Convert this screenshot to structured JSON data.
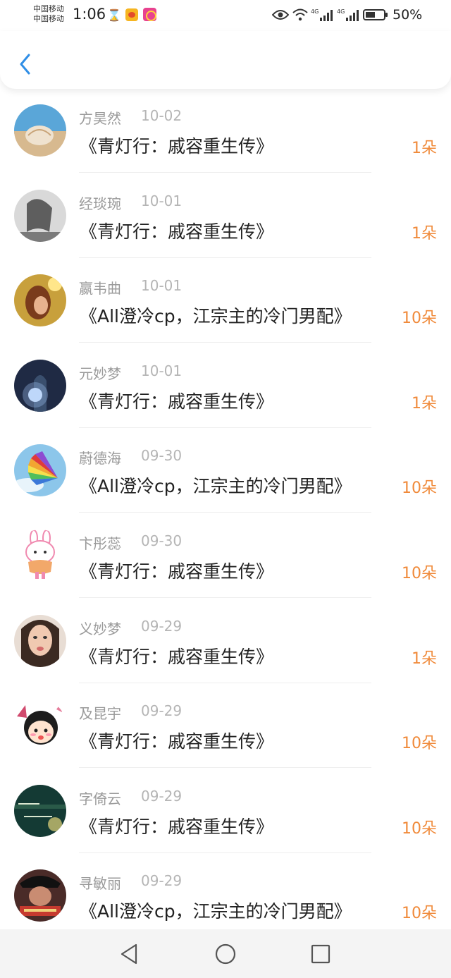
{
  "status_bar": {
    "carrier1": "中国移动",
    "carrier2": "中国移动",
    "time": "1:06",
    "signal1_label": "4G",
    "signal2_label": "4G",
    "battery_pct": "50%"
  },
  "feed": [
    {
      "name": "方昊然",
      "date": "10-02",
      "title": "《青灯行：戚容重生传》",
      "count": "1朵"
    },
    {
      "name": "经琰琬",
      "date": "10-01",
      "title": "《青灯行：戚容重生传》",
      "count": "1朵"
    },
    {
      "name": "嬴韦曲",
      "date": "10-01",
      "title": "《All澄冷cp，江宗主的冷门男配》",
      "count": "10朵"
    },
    {
      "name": "元妙梦",
      "date": "10-01",
      "title": "《青灯行：戚容重生传》",
      "count": "1朵"
    },
    {
      "name": "蔚德海",
      "date": "09-30",
      "title": "《All澄冷cp，江宗主的冷门男配》",
      "count": "10朵"
    },
    {
      "name": "卞彤蕊",
      "date": "09-30",
      "title": "《青灯行：戚容重生传》",
      "count": "10朵"
    },
    {
      "name": "义妙梦",
      "date": "09-29",
      "title": "《青灯行：戚容重生传》",
      "count": "1朵"
    },
    {
      "name": "及昆宇",
      "date": "09-29",
      "title": "《青灯行：戚容重生传》",
      "count": "10朵"
    },
    {
      "name": "字倚云",
      "date": "09-29",
      "title": "《青灯行：戚容重生传》",
      "count": "10朵"
    },
    {
      "name": "寻敏丽",
      "date": "09-29",
      "title": "《All澄冷cp，江宗主的冷门男配》",
      "count": "10朵"
    }
  ],
  "colors": {
    "accent_blue": "#2f8ee6",
    "count_orange": "#f08a3a",
    "name_gray": "#9a9a9a"
  },
  "icons": {
    "back": "chevron-left-icon",
    "nav_back": "triangle-back-icon",
    "nav_home": "circle-home-icon",
    "nav_recent": "square-recent-icon"
  }
}
